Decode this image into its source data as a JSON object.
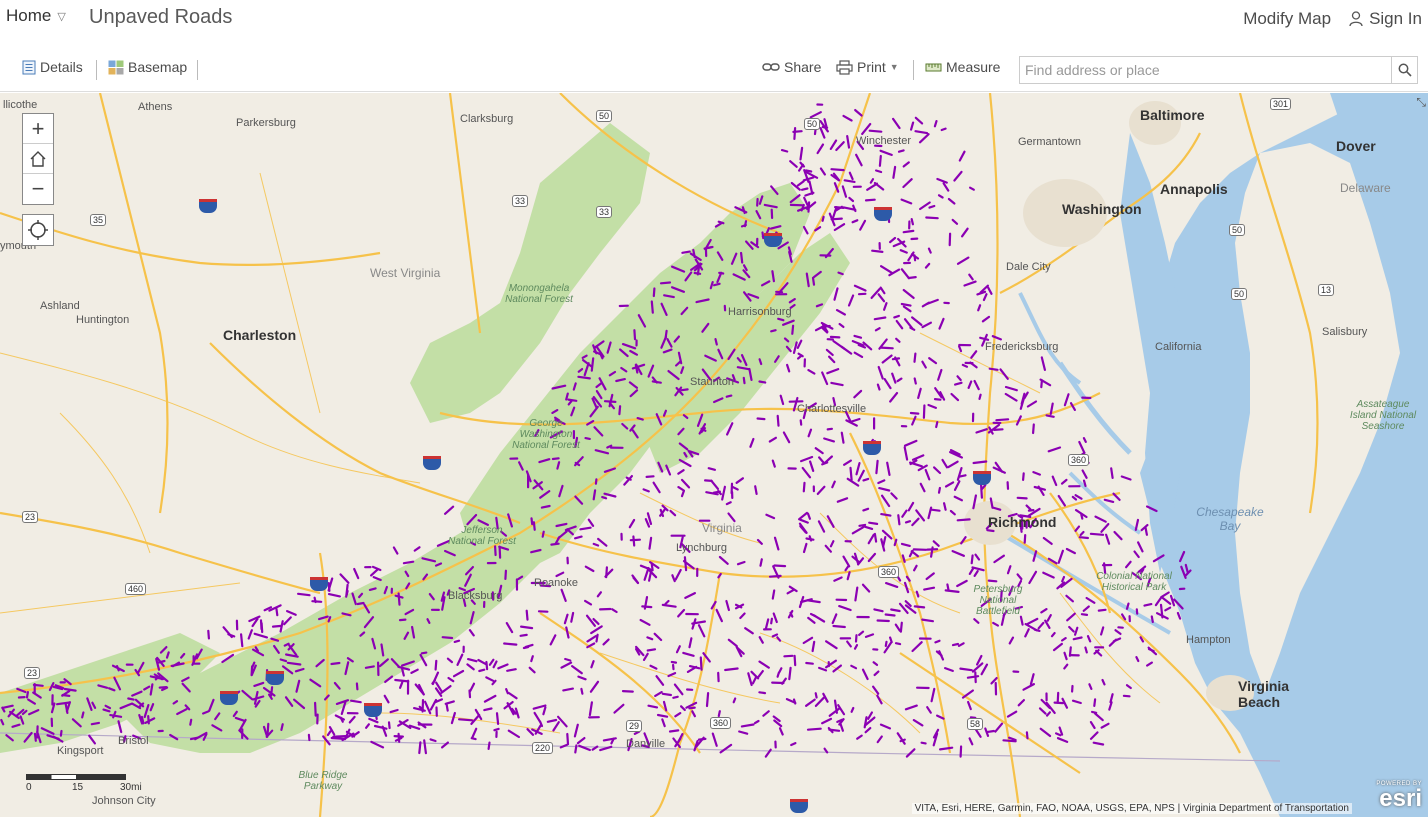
{
  "header": {
    "home_label": "Home",
    "app_title": "Unpaved Roads",
    "modify_map": "Modify Map",
    "sign_in": "Sign In"
  },
  "toolbar": {
    "details_label": "Details",
    "basemap_label": "Basemap",
    "share_label": "Share",
    "print_label": "Print",
    "measure_label": "Measure",
    "search_placeholder": "Find address or place"
  },
  "map": {
    "labels": {
      "athens": "Athens",
      "parkersburg": "Parkersburg",
      "clarksburg": "Clarksburg",
      "winchester": "Winchester",
      "germantown": "Germantown",
      "baltimore": "Baltimore",
      "dover": "Dover",
      "annapolis": "Annapolis",
      "washington": "Washington",
      "delaware": "Delaware",
      "west_virginia": "West Virginia",
      "monongahela": "Monongahela National Forest",
      "dale_city": "Dale City",
      "ashland": "Ashland",
      "huntington": "Huntington",
      "charleston": "Charleston",
      "harrisonburg": "Harrisonburg",
      "fredericksburg": "Fredericksburg",
      "california": "California",
      "salisbury": "Salisbury",
      "staunton": "Staunton",
      "charlottesville": "Charlottesville",
      "assateague": "Assateague Island National Seashore",
      "gw_forest": "George Washington National Forest",
      "richmond": "Richmond",
      "chesapeake_bay": "Chesapeake Bay",
      "jefferson_forest": "Jefferson National Forest",
      "virginia": "Virginia",
      "lynchburg": "Lynchburg",
      "roanoke": "Roanoke",
      "blacksburg": "Blacksburg",
      "colonial_park": "Colonial National Historical Park",
      "petersburg_battlefield": "Petersburg National Battlefield",
      "hampton": "Hampton",
      "virginia_beach": "Virginia Beach",
      "kingsport": "Kingsport",
      "bristol": "Bristol",
      "danville": "Danville",
      "blue_ridge": "Blue Ridge Parkway",
      "johnson_city": "Johnson City",
      "ellicotte": "llicothe",
      "ymouth": "ymouth"
    },
    "shields": [
      "50",
      "50",
      "35",
      "33",
      "33",
      "23",
      "460",
      "301",
      "50",
      "50",
      "13",
      "360",
      "360",
      "220",
      "29",
      "58",
      "360",
      "23"
    ],
    "scalebar": {
      "t0": "0",
      "t1": "15",
      "t2": "30mi"
    },
    "attribution": "VITA, Esri, HERE, Garmin, FAO, NOAA, USGS, EPA, NPS | Virginia Department of Transportation",
    "esri_powered": "POWERED BY",
    "esri_name": "esri",
    "colors": {
      "unpaved": "#8b00b3",
      "forest": "#c3dfa6",
      "water": "#a7cbe8",
      "roads": "#f6c24a",
      "land": "#f1ede4"
    }
  }
}
